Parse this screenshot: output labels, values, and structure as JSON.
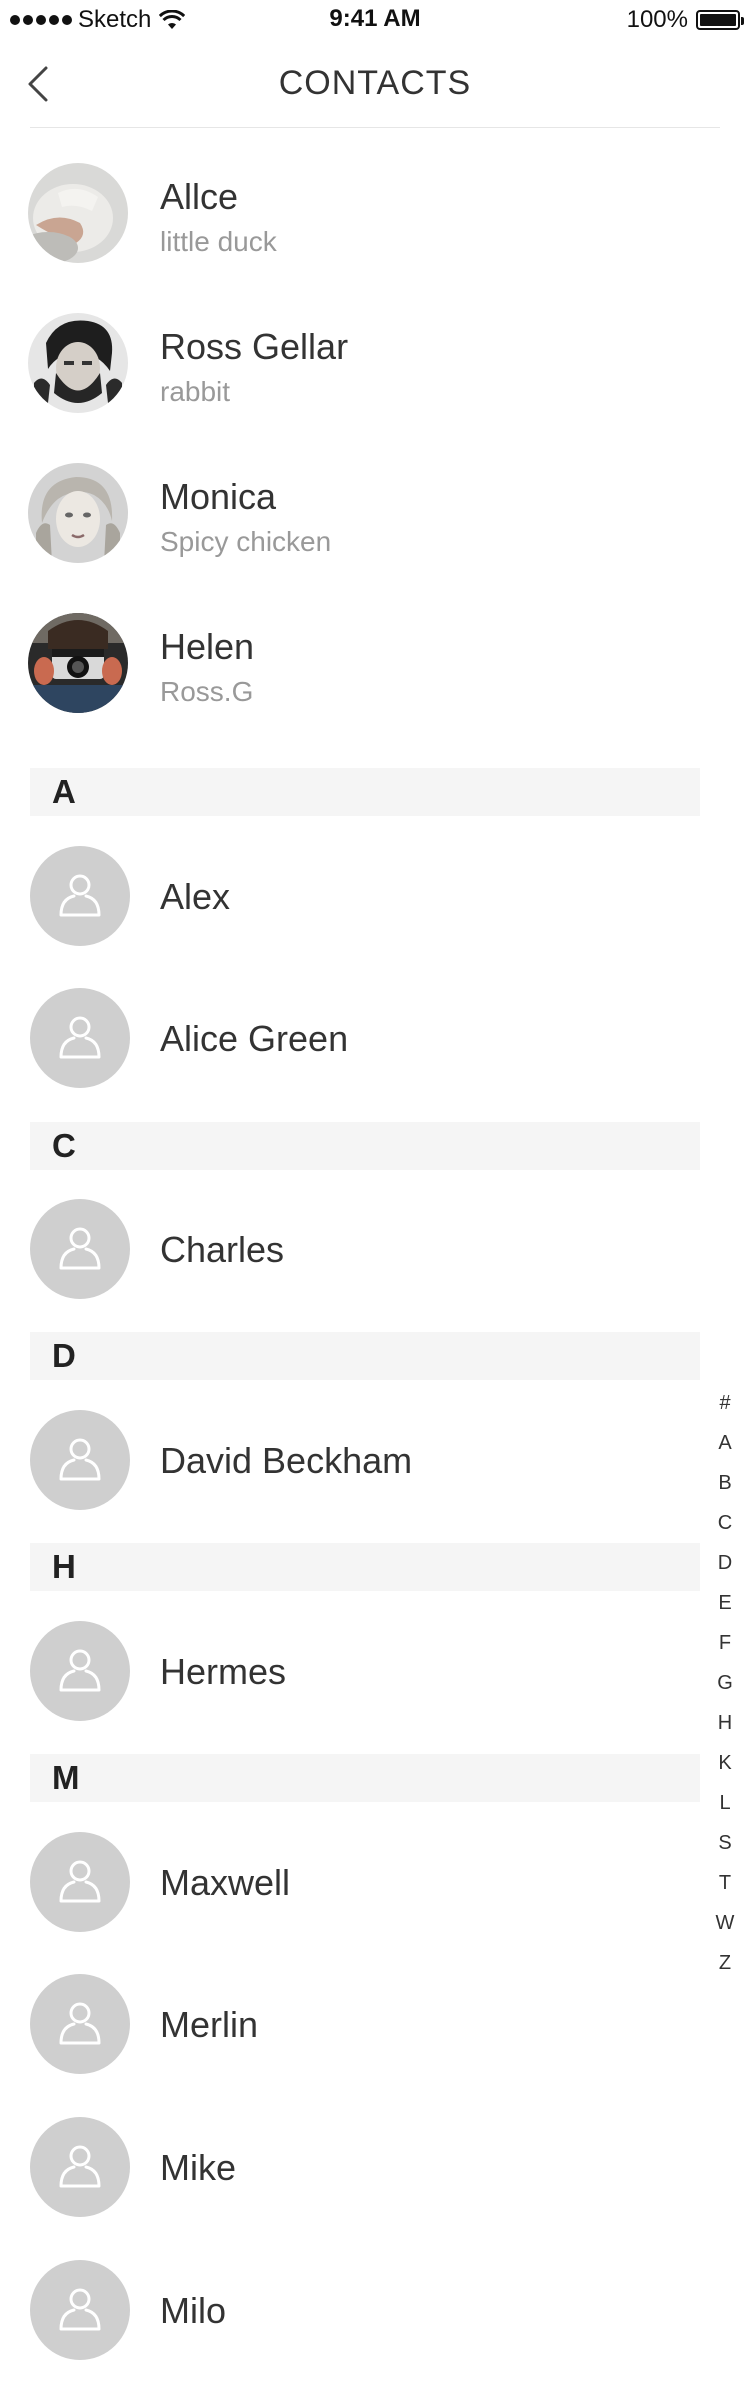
{
  "status_bar": {
    "carrier": "Sketch",
    "time": "9:41 AM",
    "battery": "100%"
  },
  "nav": {
    "title": "CONTACTS"
  },
  "favorites": [
    {
      "name": "Allce",
      "subtitle": "little duck"
    },
    {
      "name": "Ross Gellar",
      "subtitle": "rabbit"
    },
    {
      "name": "Monica",
      "subtitle": "Spicy chicken"
    },
    {
      "name": "Helen",
      "subtitle": "Ross.G"
    }
  ],
  "sections": [
    {
      "letter": "A",
      "contacts": [
        "Alex",
        "Alice Green"
      ]
    },
    {
      "letter": "C",
      "contacts": [
        "Charles"
      ]
    },
    {
      "letter": "D",
      "contacts": [
        "David Beckham"
      ]
    },
    {
      "letter": "H",
      "contacts": [
        "Hermes"
      ]
    },
    {
      "letter": "M",
      "contacts": [
        "Maxwell",
        "Merlin",
        "Mike",
        "Milo"
      ]
    }
  ],
  "index_letters": [
    "#",
    "A",
    "B",
    "C",
    "D",
    "E",
    "F",
    "G",
    "H",
    "K",
    "L",
    "S",
    "T",
    "W",
    "Z"
  ]
}
